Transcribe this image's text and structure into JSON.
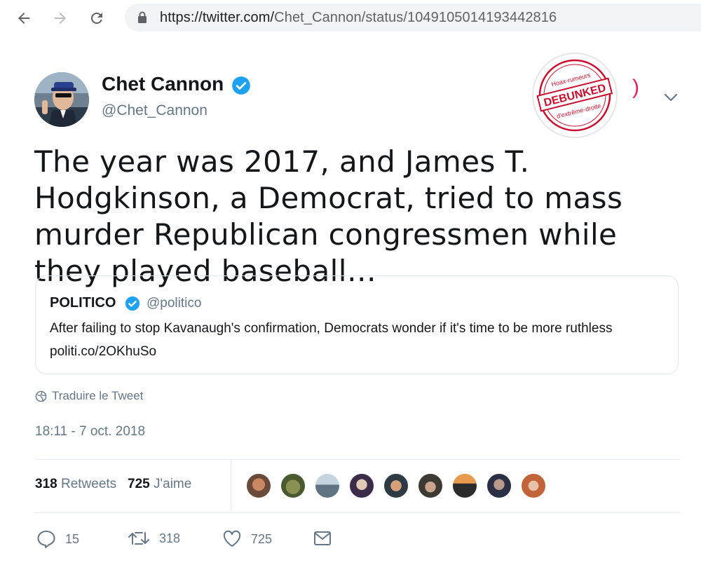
{
  "browser": {
    "url_host": "https://twitter.com/",
    "url_path": "Chet_Cannon/status/1049105014193442816"
  },
  "tweet": {
    "display_name": "Chet Cannon",
    "handle": "@Chet_Cannon",
    "text": "The year was 2017, and James T. Hodgkinson, a Democrat, tried to mass murder Republican congressmen while they played baseball…",
    "translate_label": "Traduire le Tweet",
    "timestamp": "18:11 - 7 oct. 2018",
    "retweets_count": "318",
    "retweets_label": "Retweets",
    "likes_count": "725",
    "likes_label": "J'aime"
  },
  "quoted_tweet": {
    "display_name": "POLITICO",
    "handle": "@politico",
    "text": "After failing to stop Kavanaugh's confirmation, Democrats wonder if it's time to be more ruthless politi.co/2OKhuSo"
  },
  "stamp": {
    "main": "DEBUNKED",
    "top": "Hoax-rumeurs",
    "bottom": "d'extrême-droite"
  },
  "actions": {
    "reply_count": "15",
    "retweet_count": "318",
    "like_count": "725"
  },
  "colors": {
    "verified": "#1da1f2",
    "secondary_text": "#657786",
    "stamp_red": "#c8102e"
  }
}
